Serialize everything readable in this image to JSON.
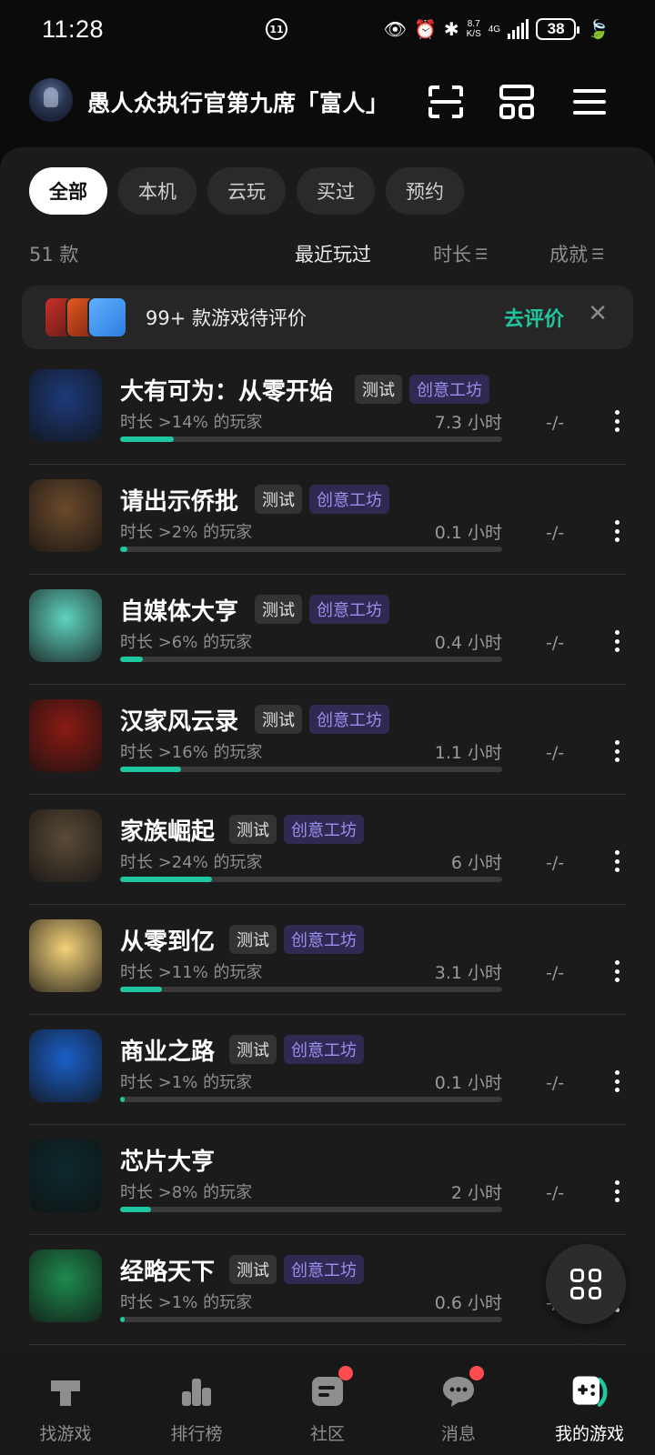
{
  "status_bar": {
    "time": "11:28",
    "center_badge": "11",
    "net_speed_top": "8.7",
    "net_speed_bottom": "K/S",
    "network_type": "4G",
    "battery": "38"
  },
  "header": {
    "user_title": "愚人众执行官第九席「富人」"
  },
  "filters": {
    "tabs": [
      {
        "label": "全部",
        "active": true
      },
      {
        "label": "本机"
      },
      {
        "label": "云玩"
      },
      {
        "label": "买过"
      },
      {
        "label": "预约"
      }
    ]
  },
  "sort_bar": {
    "count": "51 款",
    "recent": "最近玩过",
    "duration": "时长",
    "achievement": "成就"
  },
  "review_banner": {
    "text": "99+ 款游戏待评价",
    "action": "去评价",
    "close": "✕"
  },
  "games": [
    {
      "name": "大有可为：从零开始",
      "tags": [
        "测试",
        "创意工坊"
      ],
      "sub": "时长 >14% 的玩家",
      "hours": "7.3 小时",
      "achievement": "-/-",
      "progress": 0.14,
      "icon_color": "#1c3a7a"
    },
    {
      "name": "请出示侨批",
      "tags": [
        "测试",
        "创意工坊"
      ],
      "sub": "时长 >2% 的玩家",
      "hours": "0.1 小时",
      "achievement": "-/-",
      "progress": 0.02,
      "icon_color": "#6b4a2b"
    },
    {
      "name": "自媒体大亨",
      "tags": [
        "测试",
        "创意工坊"
      ],
      "sub": "时长 >6% 的玩家",
      "hours": "0.4 小时",
      "achievement": "-/-",
      "progress": 0.06,
      "icon_color": "#5fd3bf"
    },
    {
      "name": "汉家风云录",
      "tags": [
        "测试",
        "创意工坊"
      ],
      "sub": "时长 >16% 的玩家",
      "hours": "1.1 小时",
      "achievement": "-/-",
      "progress": 0.16,
      "icon_color": "#8a1a12"
    },
    {
      "name": "家族崛起",
      "tags": [
        "测试",
        "创意工坊"
      ],
      "sub": "时长 >24% 的玩家",
      "hours": "6 小时",
      "achievement": "-/-",
      "progress": 0.24,
      "icon_color": "#5a4a36"
    },
    {
      "name": "从零到亿",
      "tags": [
        "测试",
        "创意工坊"
      ],
      "sub": "时长 >11% 的玩家",
      "hours": "3.1 小时",
      "achievement": "-/-",
      "progress": 0.11,
      "icon_color": "#f4d27a"
    },
    {
      "name": "商业之路",
      "tags": [
        "测试",
        "创意工坊"
      ],
      "sub": "时长 >1% 的玩家",
      "hours": "0.1 小时",
      "achievement": "-/-",
      "progress": 0.01,
      "icon_color": "#1b5fc9"
    },
    {
      "name": "芯片大亨",
      "tags": [],
      "sub": "时长 >8% 的玩家",
      "hours": "2 小时",
      "achievement": "-/-",
      "progress": 0.08,
      "icon_color": "#0c2a2e"
    },
    {
      "name": "经略天下",
      "tags": [
        "测试",
        "创意工坊"
      ],
      "sub": "时长 >1% 的玩家",
      "hours": "0.6 小时",
      "achievement": "-/-",
      "progress": 0.01,
      "icon_color": "#1e8a4e"
    }
  ],
  "bottom_nav": [
    {
      "label": "找游戏",
      "icon": "find-game-icon",
      "badge": false
    },
    {
      "label": "排行榜",
      "icon": "ranking-icon",
      "badge": false
    },
    {
      "label": "社区",
      "icon": "community-icon",
      "badge": true
    },
    {
      "label": "消息",
      "icon": "message-icon",
      "badge": true
    },
    {
      "label": "我的游戏",
      "icon": "my-games-icon",
      "badge": false,
      "active": true
    }
  ],
  "colors": {
    "accent": "#1fc7a0",
    "workshop_tag": "#9d8ff0",
    "badge": "#ff4d4f"
  }
}
